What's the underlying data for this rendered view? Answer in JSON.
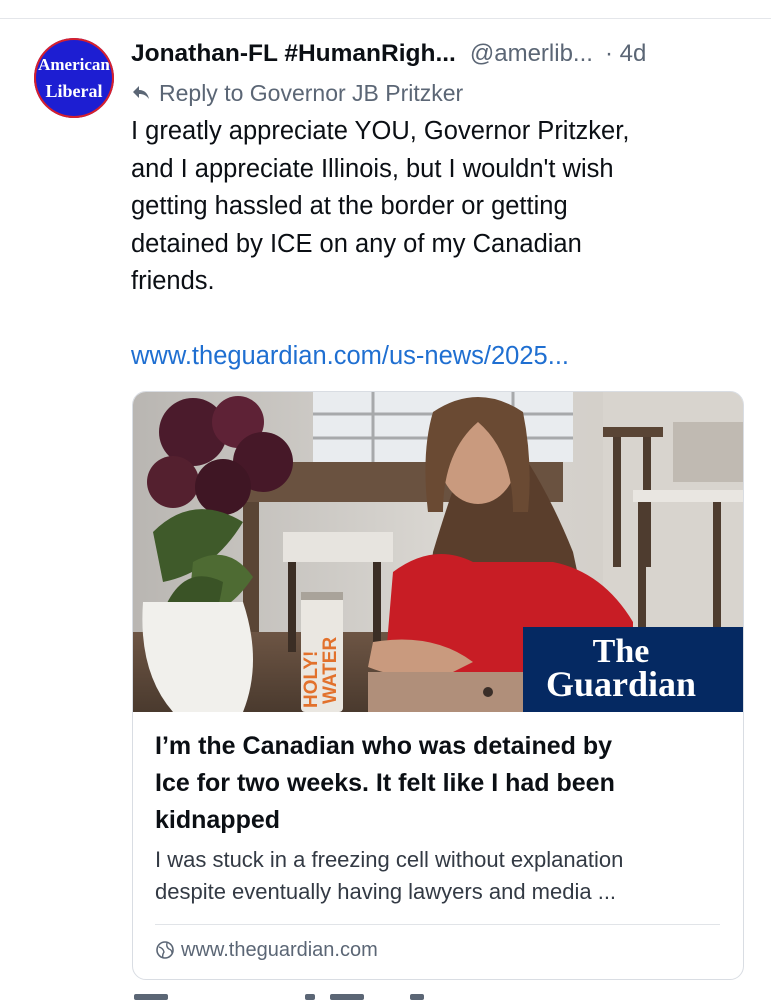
{
  "post": {
    "avatar": {
      "line1": "American",
      "line2": "Liberal",
      "colors": {
        "background": "#1d1ed2",
        "ring": "#d8202b"
      }
    },
    "author": {
      "display_name": "Jonathan-FL #HumanRigh...",
      "handle": "@amerlib...",
      "time": "· 4d"
    },
    "reply_to": "Reply to Governor JB Pritzker",
    "text_lines": [
      "I greatly appreciate YOU, Governor Pritzker,",
      "and I appreciate Illinois, but I wouldn't wish",
      "getting hassled at the border or getting",
      "detained by ICE on any of my Canadian",
      "friends."
    ],
    "link": "www.theguardian.com/us-news/2025..."
  },
  "link_card": {
    "image": {
      "can_text_line1": "HOLY!",
      "can_text_line2": "WATER",
      "badge_line1": "The",
      "badge_line2": "Guardian",
      "badge_color": "#052962"
    },
    "title_lines": [
      "I’m the Canadian who was detained by",
      "Ice for two weeks. It felt like I had been",
      "kidnapped"
    ],
    "description_lines": [
      "I was stuck in a freezing cell without explanation",
      "despite eventually having lawyers and media ..."
    ],
    "domain": "www.theguardian.com",
    "domain_icon": "globe-icon"
  },
  "theme": {
    "link_color": "#1f6fd1",
    "muted_text": "#5b6675"
  }
}
